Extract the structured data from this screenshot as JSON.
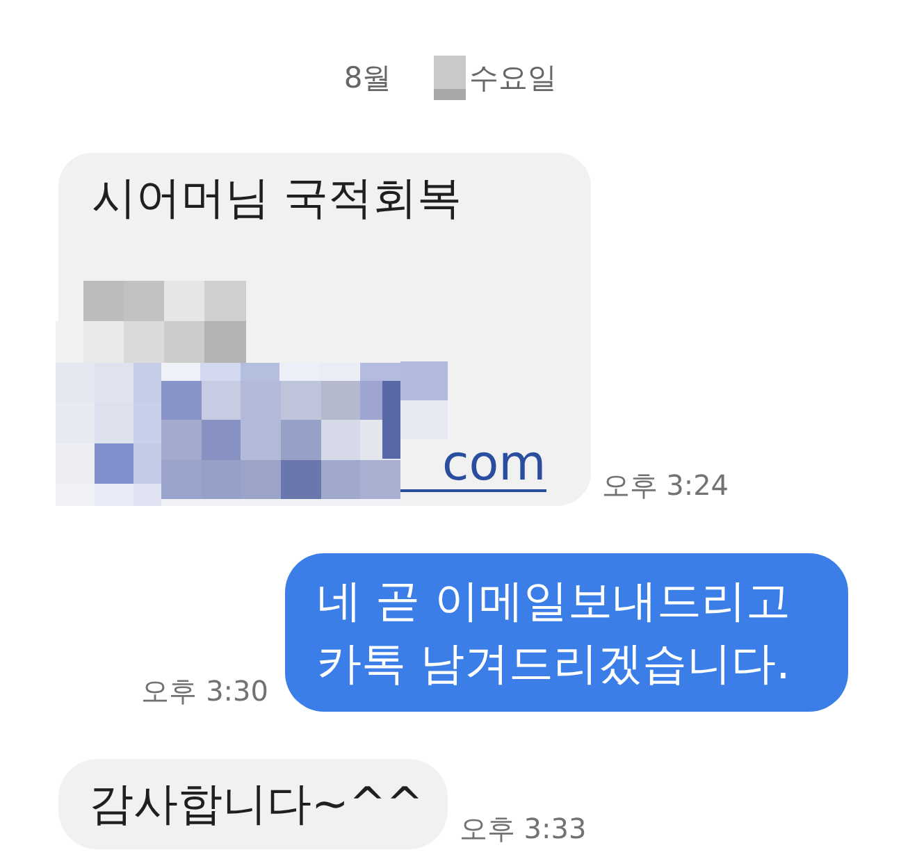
{
  "date_header": {
    "month": "8월",
    "weekday": "수요일"
  },
  "messages": [
    {
      "kind": "received",
      "text": "시어머님 국적회복",
      "redacted": true,
      "link": "com",
      "time": "오후 3:24"
    },
    {
      "kind": "sent",
      "text": "네 곧 이메일보내드리고 카톡 남겨드리겠습니다.",
      "redacted": false,
      "time": "오후 3:30"
    },
    {
      "kind": "received",
      "text": "감사합니다~^^",
      "redacted": false,
      "time": "오후 3:33"
    }
  ]
}
